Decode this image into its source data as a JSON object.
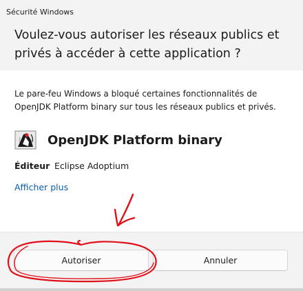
{
  "window": {
    "title": "Sécurité Windows"
  },
  "header": {
    "heading": "Voulez-vous autoriser les réseaux publics et privés à accéder à cette application ?"
  },
  "body": {
    "description": "Le pare-feu Windows a bloqué certaines fonctionnalités de OpenJDK Platform binary sur tous les réseaux publics et privés.",
    "app_name": "OpenJDK Platform binary",
    "app_icon": "java-duke-icon",
    "publisher_label": "Éditeur",
    "publisher_value": "Eclipse Adoptium",
    "more_link": "Afficher plus"
  },
  "buttons": {
    "allow": "Autoriser",
    "cancel": "Annuler"
  },
  "annotation": {
    "color": "#e0101a",
    "shapes": [
      "hand-drawn-arrow",
      "hand-drawn-circle"
    ]
  },
  "colors": {
    "link": "#0b5cad",
    "panel": "#f3f3f3",
    "surface": "#ffffff"
  }
}
